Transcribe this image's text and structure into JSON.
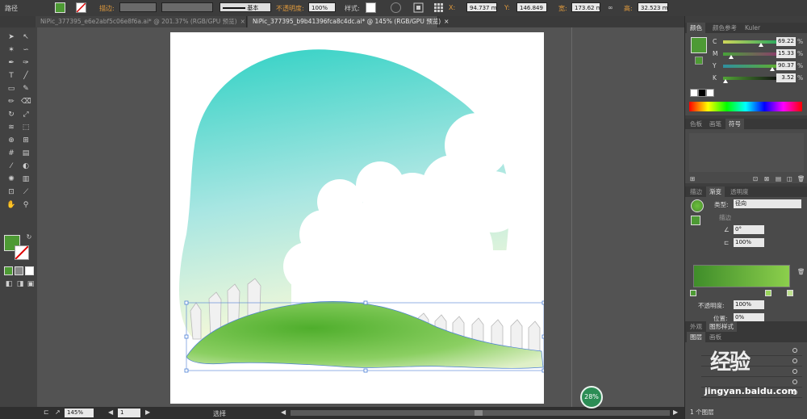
{
  "control_bar": {
    "object_type": "路径",
    "stroke_label": "描边:",
    "stroke_profile": "基本",
    "opacity_label": "不透明度:",
    "opacity_value": "100%",
    "style_label": "样式:",
    "x_label": "X:",
    "x_value": "94.737 m",
    "y_label": "Y:",
    "y_value": "146.849",
    "w_label": "宽:",
    "w_value": "173.62 m",
    "h_label": "高:",
    "h_value": "32.523 m"
  },
  "document_tabs": [
    {
      "label": "NiPic_377395_e6e2abf5c06e8f6a.ai* @ 201.37% (RGB/GPU 预览)",
      "active": false
    },
    {
      "label": "NiPic_377395_b9b41396fca8c4dc.ai* @ 145% (RGB/GPU 预览)",
      "active": true
    }
  ],
  "color_panel": {
    "tabs": [
      "颜色",
      "颜色参考",
      "Kuler"
    ],
    "channels": [
      {
        "key": "C",
        "value": "69.22",
        "unit": "%",
        "pos": 0.69
      },
      {
        "key": "M",
        "value": "15.33",
        "unit": "%",
        "pos": 0.15
      },
      {
        "key": "Y",
        "value": "90.37",
        "unit": "%",
        "pos": 0.9
      },
      {
        "key": "K",
        "value": "3.52",
        "unit": "%",
        "pos": 0.04
      }
    ],
    "fill_color": "#4d9a34"
  },
  "swatch_panel": {
    "tabs": [
      "色板",
      "画笔",
      "符号"
    ]
  },
  "gradient_panel": {
    "tabs": [
      "描边",
      "渐变",
      "透明度"
    ],
    "type_label": "类型:",
    "type_value": "径向",
    "stroke_label": "描边",
    "angle_value": "0°",
    "aspect_value": "100%",
    "opacity_label": "不透明度:",
    "opacity_value": "100%",
    "location_label": "位置:",
    "location_value": "0%"
  },
  "layers_panel": {
    "tabs_top": [
      "外观",
      "图形样式"
    ],
    "tabs": [
      "图层",
      "画板"
    ],
    "count_label": "1 个图层"
  },
  "status_bar": {
    "zoom": "145%",
    "page": "1",
    "mode": "选择"
  },
  "overlays": {
    "progress": "28%",
    "watermark": "经验",
    "watermark_site": "jingyan.baidu.com"
  },
  "colors": {
    "sky_top": "#2fd1c4",
    "hill_green": "#5cb93a",
    "accent_orange": "#e09a3c"
  }
}
